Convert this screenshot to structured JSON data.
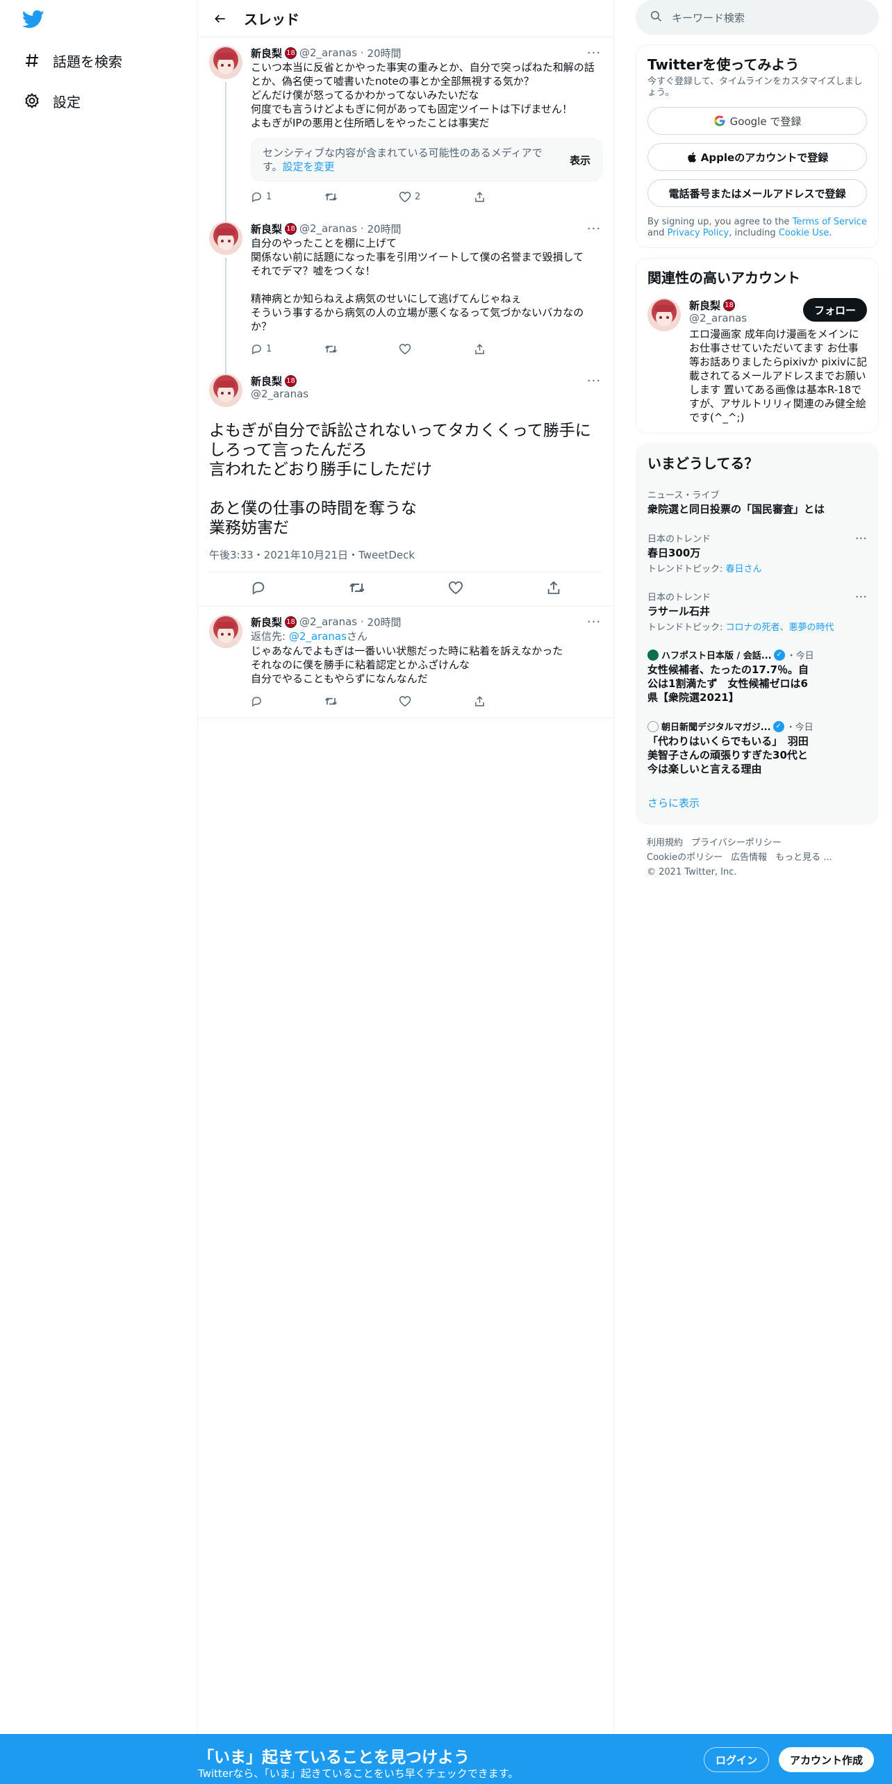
{
  "nav": {
    "explore_label": "話題を検索",
    "settings_label": "設定"
  },
  "header": {
    "title": "スレッド"
  },
  "tweets": [
    {
      "name": "新良梨",
      "badge": "18",
      "handle": "@2_aranas",
      "time": "20時間",
      "text": "こいつ本当に反省とかやった事実の重みとか、自分で突っぱねた和解の話とか、偽名使って嘘書いたnoteの事とか全部無視する気か？\nどんだけ僕が怒ってるかわかってないみたいだな\n何度でも言うけどよもぎに何があっても固定ツイートは下げません！\nよもぎがIPの悪用と住所晒しをやったことは事実だ",
      "sensitive_text": "センシティブな内容が含まれている可能性のあるメディアです。",
      "sensitive_link": "設定を変更",
      "sensitive_button": "表示",
      "replies": "1",
      "retweets": "",
      "likes": "2"
    },
    {
      "name": "新良梨",
      "badge": "18",
      "handle": "@2_aranas",
      "time": "20時間",
      "text": "自分のやったことを棚に上げて\n関係ない前に話題になった事を引用ツイートして僕の名誉まで毀損して\nそれでデマ？嘘をつくな！\n\n精神病とか知らねえよ病気のせいにして逃げてんじゃねぇ\nそういう事するから病気の人の立場が悪くなるって気づかないバカなのか？",
      "replies": "1",
      "retweets": "",
      "likes": ""
    }
  ],
  "focal": {
    "name": "新良梨",
    "badge": "18",
    "handle": "@2_aranas",
    "text": "よもぎが自分で訴訟されないってタカくくって勝手にしろって言ったんだろ\n言われたどおり勝手にしただけ\n\nあと僕の仕事の時間を奪うな\n業務妨害だ",
    "timestamp": "午後3:33・2021年10月21日・TweetDeck"
  },
  "reply": {
    "name": "新良梨",
    "badge": "18",
    "handle": "@2_aranas",
    "time": "20時間",
    "reply_prefix": "返信先: ",
    "reply_to": "@2_aranas",
    "reply_suffix": "さん",
    "text": "じゃあなんでよもぎは一番いい状態だった時に粘着を訴えなかった\nそれなのに僕を勝手に粘着認定とかふざけんな\n自分でやることもやらずになんなんだ"
  },
  "sidebar": {
    "search_placeholder": "キーワード検索",
    "signup": {
      "title": "Twitterを使ってみよう",
      "subtitle": "今すぐ登録して、タイムラインをカスタマイズしましょう。",
      "google": "Google で登録",
      "apple": "Appleのアカウントで登録",
      "phone": "電話番号またはメールアドレスで登録",
      "legal_1": "By signing up, you agree to the ",
      "terms": "Terms of Service",
      "legal_2": " and ",
      "privacy": "Privacy Policy",
      "legal_3": ", including ",
      "cookie": "Cookie Use",
      "legal_4": "."
    },
    "related": {
      "title": "関連性の高いアカウント",
      "name": "新良梨",
      "badge": "18",
      "handle": "@2_aranas",
      "follow": "フォロー",
      "bio": "エロ漫画家 成年向け漫画をメインにお仕事させていただいてます お仕事等お話ありましたらpixivか pixivに記載されてるメールアドレスまでお願いします 置いてある画像は基本R-18ですが、アサルトリリィ関連のみ健全絵です(^_^;)"
    },
    "trends": {
      "title": "いまどうしてる？",
      "items": [
        {
          "context": "ニュース・ライブ",
          "name": "衆院選と同日投票の「国民審査」とは"
        },
        {
          "context": "日本のトレンド",
          "name": "春日300万",
          "topic_label": "トレンドトピック: ",
          "topic": "春日さん"
        },
        {
          "context": "日本のトレンド",
          "name": "ラサール石井",
          "topic_label": "トレンドトピック: ",
          "topic": "コロナの死者、悪夢の時代"
        }
      ],
      "news": [
        {
          "source": "ハフポスト日本版 / 会話...",
          "time": "・今日",
          "headline": "女性候補者、たったの17.7％。自公は1割満たず　女性候補ゼロは6県【衆院選2021】"
        },
        {
          "source": "朝日新聞デジタルマガジ...",
          "time": "・今日",
          "headline": "「代わりはいくらでもいる」　羽田美智子さんの頑張りすぎた30代と今は楽しいと言える理由"
        }
      ],
      "more": "さらに表示"
    },
    "footer": {
      "terms": "利用規約",
      "privacy": "プライバシーポリシー",
      "cookie": "Cookieのポリシー",
      "ads": "広告情報",
      "more": "もっと見る ...",
      "copyright": "© 2021 Twitter, Inc."
    }
  },
  "bottombar": {
    "title": "「いま」起きていることを見つけよう",
    "subtitle": "Twitterなら、「いま」起きていることをいち早くチェックできます。",
    "login": "ログイン",
    "signup": "アカウント作成"
  },
  "colors": {
    "accent": "#1d9bf0",
    "text": "#0f1419",
    "muted": "#536471",
    "badge": "#b5001f"
  }
}
